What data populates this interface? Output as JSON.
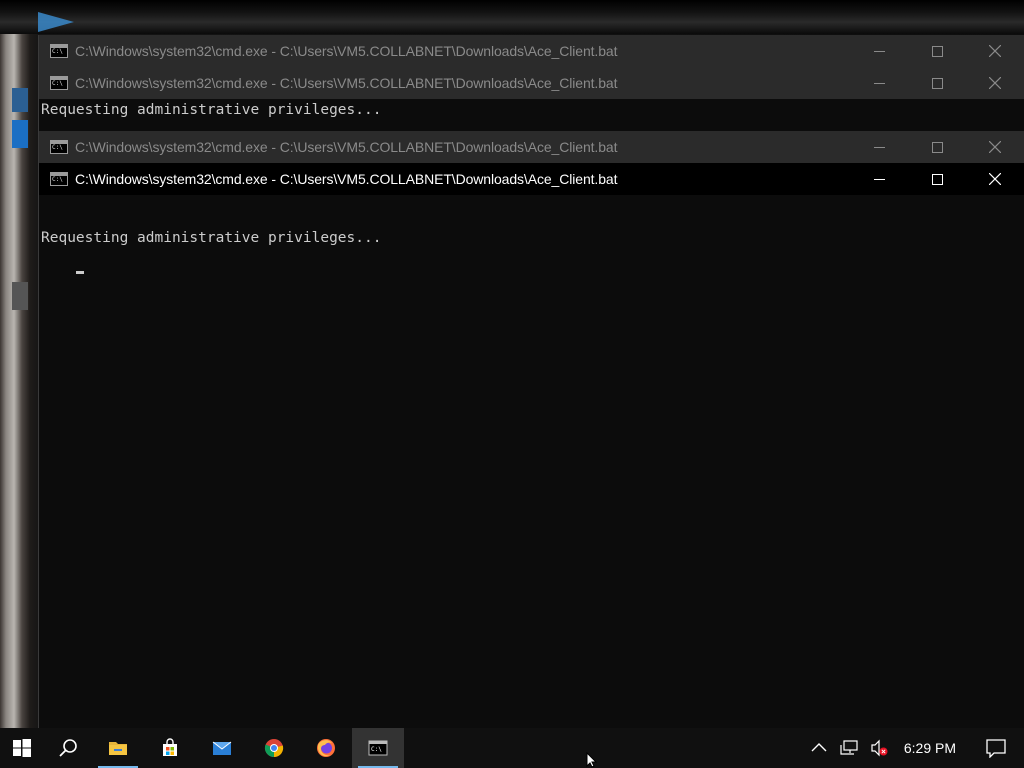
{
  "windows": [
    {
      "title": "C:\\Windows\\system32\\cmd.exe - C:\\Users\\VM5.COLLABNET\\Downloads\\Ace_Client.bat",
      "lines": [],
      "state": "inactive"
    },
    {
      "title": "C:\\Windows\\system32\\cmd.exe - C:\\Users\\VM5.COLLABNET\\Downloads\\Ace_Client.bat",
      "lines": [
        "Requesting administrative privileges..."
      ],
      "state": "inactive"
    },
    {
      "title": "C:\\Windows\\system32\\cmd.exe - C:\\Users\\VM5.COLLABNET\\Downloads\\Ace_Client.bat",
      "lines": [],
      "state": "inactive"
    },
    {
      "title": "C:\\Windows\\system32\\cmd.exe - C:\\Users\\VM5.COLLABNET\\Downloads\\Ace_Client.bat",
      "lines": [
        "Requesting administrative privileges..."
      ],
      "state": "active"
    }
  ],
  "taskbar": {
    "pinned": [
      {
        "name": "start-button",
        "icon": "windows-logo-icon"
      },
      {
        "name": "search-button",
        "icon": "search-icon"
      },
      {
        "name": "file-explorer-button",
        "icon": "folder-icon",
        "running": true
      },
      {
        "name": "store-button",
        "icon": "store-icon"
      },
      {
        "name": "mail-button",
        "icon": "mail-icon"
      },
      {
        "name": "chrome-button",
        "icon": "chrome-icon"
      },
      {
        "name": "firefox-button",
        "icon": "firefox-icon"
      },
      {
        "name": "cmd-button",
        "icon": "cmd-icon",
        "active": true,
        "running": true
      }
    ],
    "tray": {
      "icons": [
        "chevron-up-icon",
        "network-icon",
        "volume-muted-icon"
      ],
      "time": "6:29 PM",
      "notification_icon": "action-center-icon"
    }
  },
  "colors": {
    "console_bg": "#0c0c0c",
    "console_text": "#cccccc",
    "active_title_bg": "#000000",
    "inactive_title_bg": "#2b2b2b",
    "taskbar_bg": "#101010",
    "accent": "#76b9ed"
  }
}
